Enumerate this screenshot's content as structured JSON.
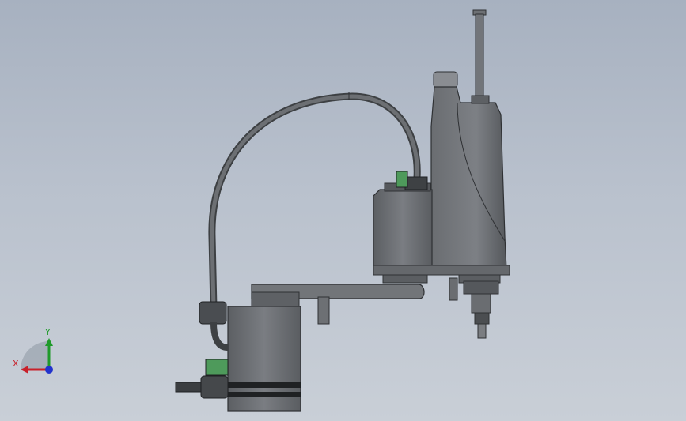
{
  "triad": {
    "x_label": "X",
    "y_label": "Y",
    "x_color": "#c8202a",
    "y_color": "#1f9a2a",
    "z_color": "#2233cc"
  },
  "model": {
    "body_color": "#6f7276",
    "connector_color": "#4e9a5b",
    "cable_color": "#5a5d61"
  }
}
